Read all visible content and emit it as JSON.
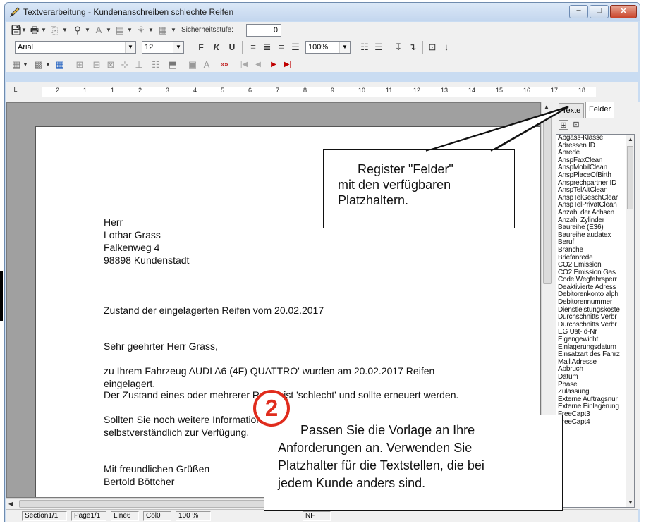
{
  "window": {
    "title": "Textverarbeitung - Kundenanschreiben schlechte Reifen"
  },
  "toolbar1": {
    "security_label": "Sicherheitsstufe:",
    "security_value": "0"
  },
  "toolbar2": {
    "font": "Arial",
    "size": "12",
    "bold": "F",
    "italic": "K",
    "underline": "U",
    "zoom": "100%"
  },
  "ruler": {
    "marks": [
      "2",
      "1",
      "1",
      "2",
      "3",
      "4",
      "5",
      "6",
      "7",
      "8",
      "9",
      "10",
      "11",
      "12",
      "13",
      "14",
      "15",
      "16",
      "17",
      "18"
    ]
  },
  "document": {
    "lines": [
      "Herr",
      "Lothar Grass",
      "Falkenweg 4",
      "98898 Kundenstadt",
      "Zustand der eingelagerten Reifen vom 20.02.2017",
      "Sehr geehrter Herr Grass,",
      "zu Ihrem Fahrzeug AUDI A6 (4F) QUATTRO' wurden am 20.02.2017 Reifen",
      "eingelagert.",
      "Der Zustand eines oder mehrerer Reifen ist 'schlecht' und sollte erneuert werden.",
      "Sollten Sie noch weitere Informationen benötigen, stehen wir Ihnen",
      "selbstverständlich zur Verfügung.",
      "Mit freundlichen Grüßen",
      "Bertold Böttcher"
    ]
  },
  "side_panel": {
    "tabs": [
      "Texte",
      "Felder"
    ],
    "fields": [
      "Abgass-Klasse",
      "Adressen ID",
      "Anrede",
      "AnspFaxClean",
      "AnspMobilClean",
      "AnspPlaceOfBirth",
      "Ansprechpartner ID",
      "AnspTelAltClean",
      "AnspTelGeschClear",
      "AnspTelPrivatClean",
      "Anzahl der Achsen",
      "Anzahl Zylinder",
      "Baureihe (E36)",
      "Baureihe audatex",
      "Beruf",
      "Branche",
      "Briefanrede",
      "CO2 Emission",
      "CO2 Emission Gas",
      "Code Wegfahrsperr",
      "Deaktivierte Adress",
      "Debitorenkonto alph",
      "Debitorennummer",
      "Dienstleistungskoste",
      "Durchschnitts Verbr",
      "Durchschnitts Verbr",
      "EG Ust-Id-Nr",
      "Eigengewicht",
      "Einlagerungsdatum",
      "Einsatzart des Fahrz",
      "Mail Adresse",
      "Abbruch",
      "Datum",
      "Phase",
      "Zulassung",
      "Externe Auftragsnur",
      "Externe Einlagerung",
      "FreeCapt3",
      "FreeCapt4"
    ]
  },
  "status": {
    "section": "Section1/1",
    "page": "Page1/1",
    "line": "Line6",
    "col": "Col0",
    "zoom": "100 %",
    "nf": "NF"
  },
  "callouts": {
    "felder": [
      "Register \"Felder\"",
      "mit den verfügbaren",
      "Platzhaltern."
    ],
    "badge": "2",
    "vorlage": [
      "Passen Sie die Vorlage an Ihre",
      "Anforderungen an. Verwenden Sie",
      "Platzhalter für die Textstellen, die bei",
      "jedem Kunde anders sind."
    ]
  }
}
